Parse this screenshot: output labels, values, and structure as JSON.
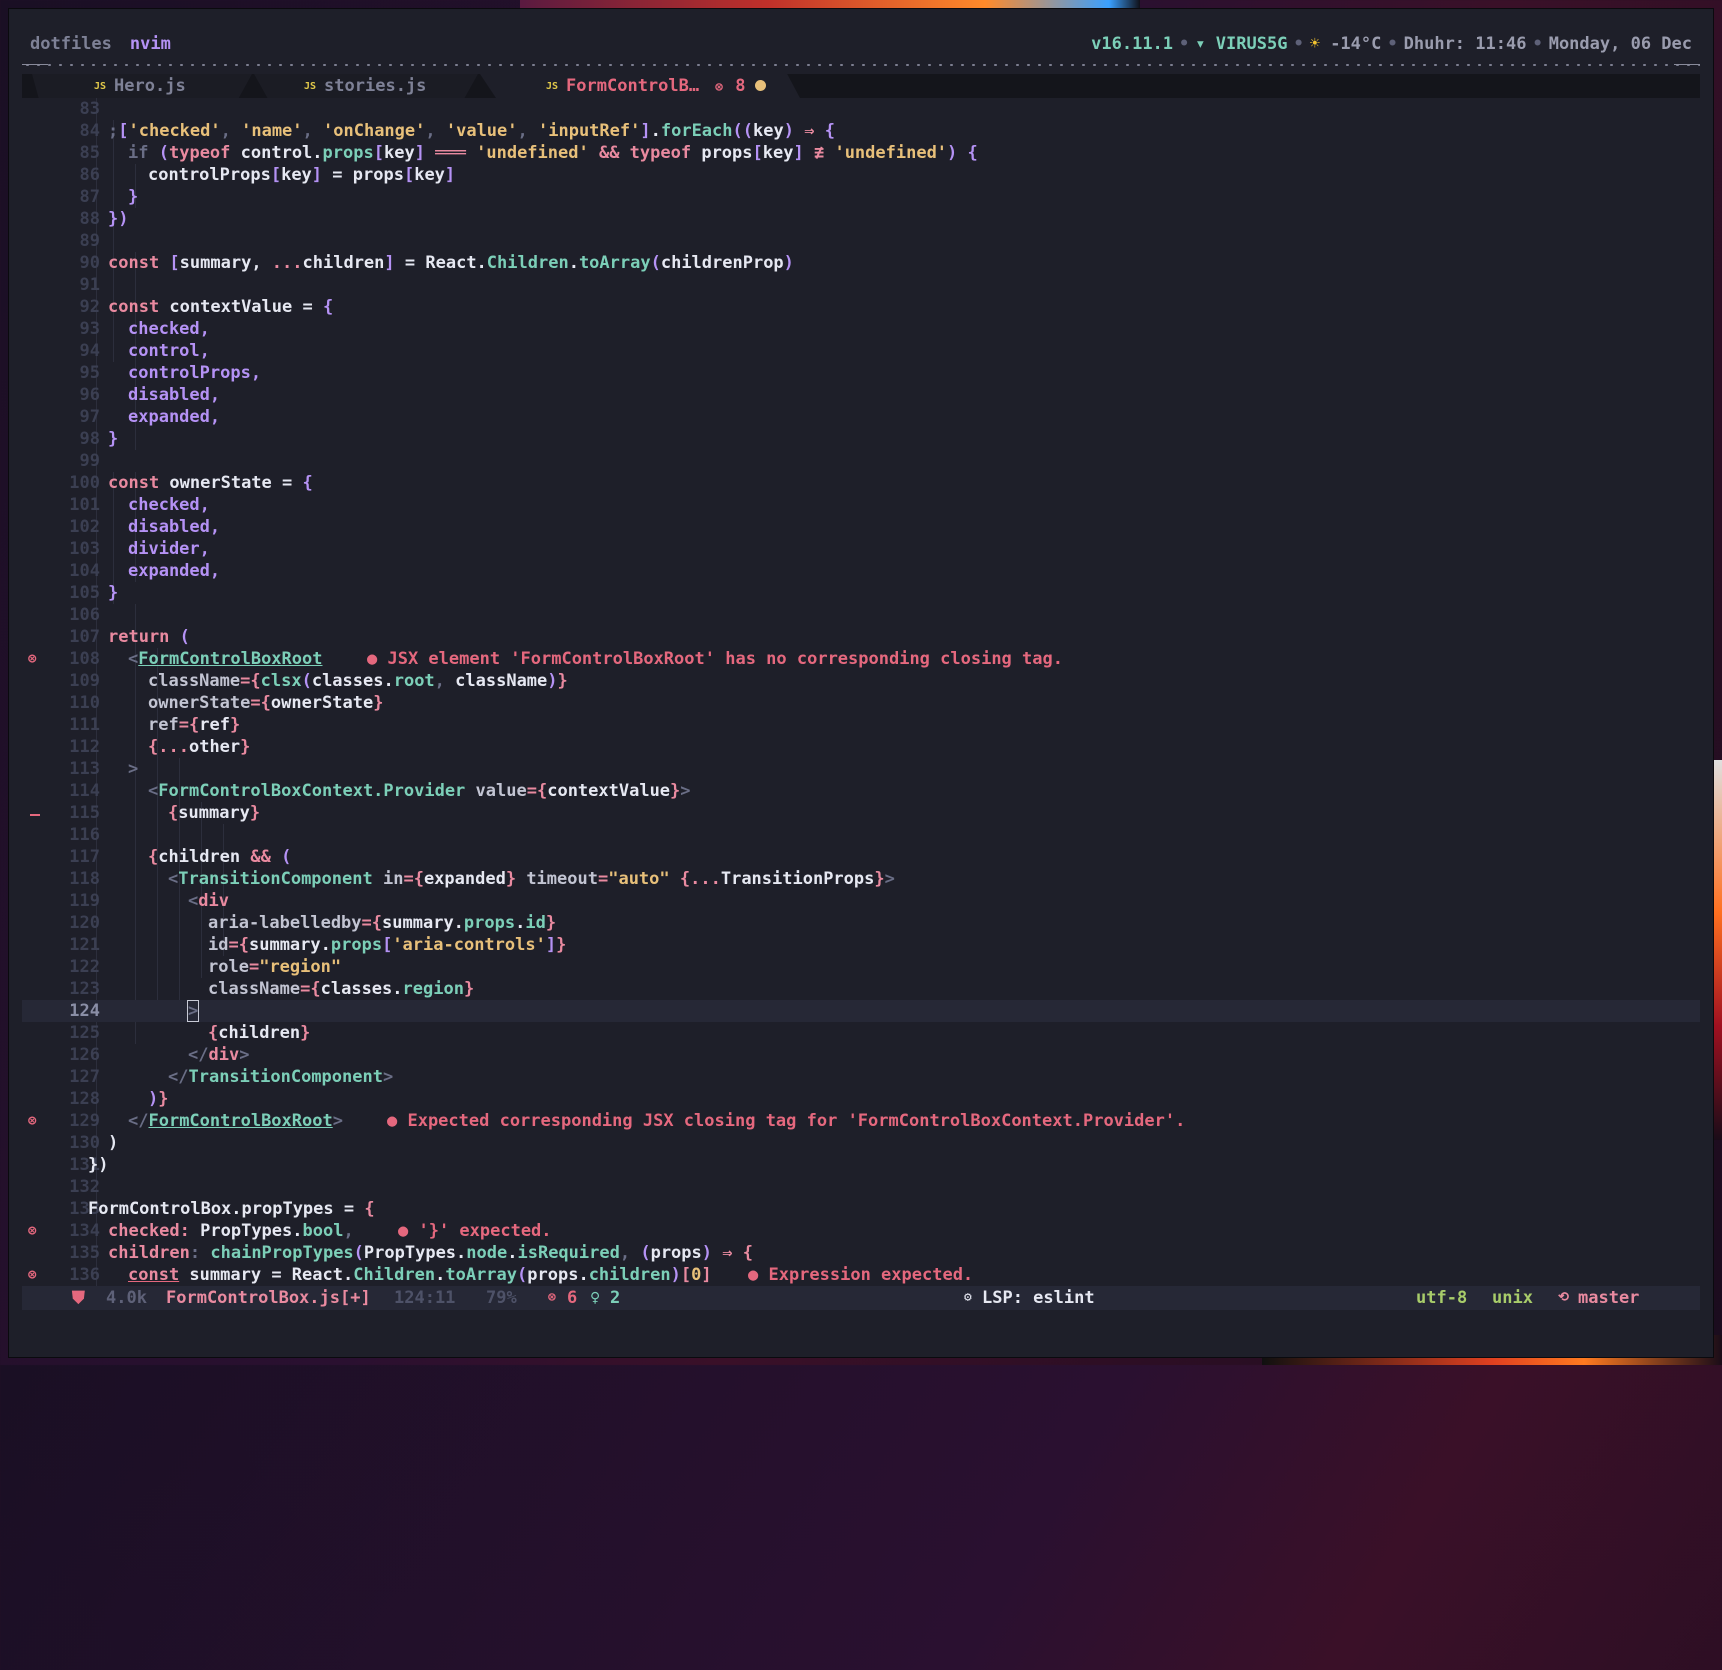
{
  "topbar": {
    "session": "dotfiles",
    "window": "nvim",
    "node_version": "v16.11.1",
    "wifi_icon": "wifi-icon",
    "network": "VIRUS5G",
    "weather_icon": "sun-icon",
    "temperature": "-14°C",
    "prayer": "Dhuhr: 11:46",
    "date": "Monday, 06 Dec",
    "separator": "•"
  },
  "tabs": [
    {
      "icon": "JS",
      "label": "Hero.js",
      "active": false
    },
    {
      "icon": "JS",
      "label": "stories.js",
      "active": false
    },
    {
      "icon": "JS",
      "label": "FormControlB…",
      "active": true,
      "error_icon": "⊗",
      "error_count": "8",
      "modified": true
    }
  ],
  "editor": {
    "cursor_line": 124,
    "lines": [
      {
        "n": "83"
      },
      {
        "n": "84"
      },
      {
        "n": "85"
      },
      {
        "n": "86"
      },
      {
        "n": "87"
      },
      {
        "n": "88"
      },
      {
        "n": "89"
      },
      {
        "n": "90"
      },
      {
        "n": "91"
      },
      {
        "n": "92"
      },
      {
        "n": "93"
      },
      {
        "n": "94"
      },
      {
        "n": "95"
      },
      {
        "n": "96"
      },
      {
        "n": "97"
      },
      {
        "n": "98"
      },
      {
        "n": "99"
      },
      {
        "n": "100"
      },
      {
        "n": "101"
      },
      {
        "n": "102"
      },
      {
        "n": "103"
      },
      {
        "n": "104"
      },
      {
        "n": "105"
      },
      {
        "n": "106"
      },
      {
        "n": "107"
      },
      {
        "n": "108",
        "sign": "⊗"
      },
      {
        "n": "109"
      },
      {
        "n": "110"
      },
      {
        "n": "111"
      },
      {
        "n": "112"
      },
      {
        "n": "113"
      },
      {
        "n": "114"
      },
      {
        "n": "115",
        "git": "removed"
      },
      {
        "n": "116"
      },
      {
        "n": "117"
      },
      {
        "n": "118"
      },
      {
        "n": "119"
      },
      {
        "n": "120"
      },
      {
        "n": "121"
      },
      {
        "n": "122"
      },
      {
        "n": "123"
      },
      {
        "n": "124"
      },
      {
        "n": "125"
      },
      {
        "n": "126"
      },
      {
        "n": "127"
      },
      {
        "n": "128"
      },
      {
        "n": "129",
        "sign": "⊗"
      },
      {
        "n": "130"
      },
      {
        "n": "131"
      },
      {
        "n": "132"
      },
      {
        "n": "133"
      },
      {
        "n": "134",
        "sign": "⊗"
      },
      {
        "n": "135"
      },
      {
        "n": "136",
        "sign": "⊗"
      }
    ],
    "code": {
      "l84": [
        ";",
        "[",
        "'checked'",
        ", ",
        "'name'",
        ", ",
        "'onChange'",
        ", ",
        "'value'",
        ", ",
        "'inputRef'",
        "]",
        ".",
        "forEach",
        "(",
        "(",
        "key",
        ")",
        " ⇒ ",
        "{"
      ],
      "l85": [
        "if",
        " ",
        "(",
        "typeof",
        " control.",
        "props",
        "[",
        "key",
        "]",
        " ═══ ",
        "'undefined'",
        " && ",
        "typeof",
        " props",
        "[",
        "key",
        "]",
        " ≢ ",
        "'undefined'",
        ")",
        " {"
      ],
      "l86": [
        "controlProps",
        "[",
        "key",
        "]",
        " = ",
        "props",
        "[",
        "key",
        "]"
      ],
      "l87": "}",
      "l88": [
        "}",
        ")"
      ],
      "l90": [
        "const",
        " [",
        "summary, ",
        "...",
        "children",
        "]",
        " = ",
        "React.",
        "Children",
        ".",
        "toArray",
        "(",
        "childrenProp",
        ")"
      ],
      "l92": [
        "const",
        " contextValue",
        " = ",
        "{"
      ],
      "l93": "checked,",
      "l94": "control,",
      "l95": "controlProps,",
      "l96": "disabled,",
      "l97": "expanded,",
      "l98": "}",
      "l100": [
        "const",
        " ownerState",
        " = ",
        "{"
      ],
      "l101": "checked,",
      "l102": "disabled,",
      "l103": "divider,",
      "l104": "expanded,",
      "l105": "}",
      "l107": [
        "return",
        " ("
      ],
      "l108": [
        "<",
        "FormControlBoxRoot"
      ],
      "l109": [
        "className",
        "=",
        "{",
        "clsx",
        "(",
        "classes.",
        "root",
        ", ",
        "className",
        ")",
        "}"
      ],
      "l110": [
        "ownerState",
        "=",
        "{",
        "ownerState",
        "}"
      ],
      "l111": [
        "ref",
        "=",
        "{",
        "ref",
        "}"
      ],
      "l112": [
        "{",
        "...",
        "other",
        "}"
      ],
      "l113": ">",
      "l114": [
        "<",
        "FormControlBoxContext.Provider",
        " value",
        "=",
        "{",
        "contextValue",
        "}",
        ">"
      ],
      "l115": [
        "{",
        "summary",
        "}"
      ],
      "l117": [
        "{",
        "children",
        " && ",
        "("
      ],
      "l118": [
        "<",
        "TransitionComponent",
        " in",
        "=",
        "{",
        "expanded",
        "}",
        " timeout",
        "=",
        "\"auto\"",
        " {",
        "...",
        "TransitionProps",
        "}",
        ">"
      ],
      "l119": [
        "<",
        "div"
      ],
      "l120": [
        "aria-labelledby",
        "=",
        "{",
        "summary.",
        "props",
        ".",
        "id",
        "}"
      ],
      "l121": [
        "id",
        "=",
        "{",
        "summary.",
        "props",
        "[",
        "'aria-controls'",
        "]",
        "}"
      ],
      "l122": [
        "role",
        "=",
        "\"region\""
      ],
      "l123": [
        "className",
        "=",
        "{",
        "classes.",
        "region",
        "}"
      ],
      "l124": ">",
      "l125": [
        "{",
        "children",
        "}"
      ],
      "l126": [
        "</",
        "div",
        ">"
      ],
      "l127": [
        "</",
        "TransitionComponent",
        ">"
      ],
      "l128": [
        ")",
        "}"
      ],
      "l129": [
        "</",
        "FormControlBoxRoot",
        ">"
      ],
      "l130": ")",
      "l131": "})",
      "l133": [
        "FormControlBox.propTypes",
        " = ",
        "{"
      ],
      "l134": [
        "checked",
        ":",
        " PropTypes.",
        "bool",
        ","
      ],
      "l135": [
        "children",
        ":",
        " chainPropTypes",
        "(",
        "PropTypes.",
        "node",
        ".",
        "isRequired",
        ", ",
        "(",
        "props",
        ")",
        " ⇒ ",
        "{"
      ],
      "l136": [
        "const",
        " summary",
        " = ",
        "React.",
        "Children",
        ".",
        "toArray",
        "(",
        "props.",
        "children",
        ")",
        "[",
        "0",
        "]"
      ]
    },
    "diagnostics": {
      "l108": "● JSX element 'FormControlBoxRoot' has no corresponding closing tag.",
      "l129": "● Expected corresponding JSX closing tag for 'FormControlBoxContext.Provider'.",
      "l134": "● '}' expected.",
      "l136": "● Expression expected."
    }
  },
  "statusline": {
    "mode_icon": "shield-icon",
    "file_size": "4.0k",
    "file_name": "FormControlBox.js[+]",
    "position": "124:11",
    "percent": "79%",
    "error_icon": "⊗",
    "errors": "6",
    "hint_icon": "lightbulb-icon",
    "hints": "2",
    "lsp_icon": "gear-icon",
    "lsp": "LSP: eslint",
    "encoding": "utf-8",
    "format": "unix",
    "branch_icon": "git-branch-icon",
    "branch": "master"
  }
}
